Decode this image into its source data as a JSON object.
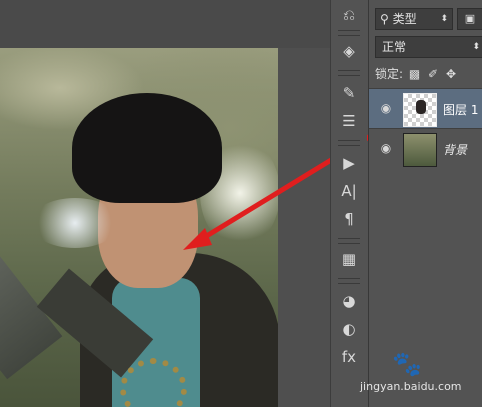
{
  "layers_panel": {
    "filter_label": "类型",
    "filter_icons": [
      "search-icon",
      "image-filter-icon"
    ],
    "blend_mode": "正常",
    "lock_label": "锁定:",
    "layers": [
      {
        "name": "图层 1",
        "selected": true,
        "visible": true
      },
      {
        "name": "背景",
        "selected": false,
        "visible": true
      }
    ]
  },
  "toolbar": {
    "tools": [
      "history-icon",
      "3d-icon",
      "adjustment-brush-icon",
      "properties-icon",
      "play-icon",
      "character-icon",
      "paragraph-icon",
      "grid-icon",
      "swatches-icon",
      "styles-icon",
      "fx-icon"
    ]
  },
  "watermark": {
    "line2": "jingyan.baidu.com"
  },
  "colors": {
    "panel_bg": "#535353",
    "selected_layer": "#5c6d80",
    "arrow": "#e01e1e"
  }
}
